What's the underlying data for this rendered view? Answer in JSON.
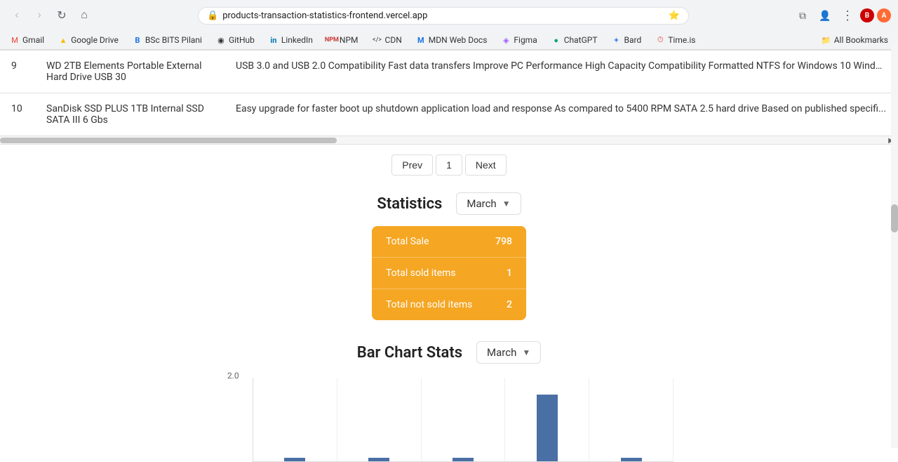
{
  "browser": {
    "url": "products-transaction-statistics-frontend.vercel.app",
    "nav": {
      "back": "‹",
      "forward": "›",
      "reload": "↻",
      "home": "⌂"
    },
    "bookmarks": [
      {
        "label": "Gmail",
        "icon": "M"
      },
      {
        "label": "Google Drive",
        "icon": "▲"
      },
      {
        "label": "BSc BITS Pilani",
        "icon": "B"
      },
      {
        "label": "GitHub",
        "icon": "◉"
      },
      {
        "label": "LinkedIn",
        "icon": "in"
      },
      {
        "label": "NPM",
        "icon": "◼"
      },
      {
        "label": "CDN",
        "icon": "</>"
      },
      {
        "label": "MDN Web Docs",
        "icon": "M"
      },
      {
        "label": "Figma",
        "icon": "◈"
      },
      {
        "label": "ChatGPT",
        "icon": "●"
      },
      {
        "label": "Bard",
        "icon": "✦"
      },
      {
        "label": "Time.is",
        "icon": "⏱"
      },
      {
        "label": "All Bookmarks",
        "icon": "☆"
      }
    ]
  },
  "table": {
    "rows": [
      {
        "number": "9",
        "name": "WD 2TB Elements Portable External Hard Drive USB 30",
        "description": "USB 3.0 and USB 2.0 Compatibility Fast data transfers Improve PC Performance High Capacity Compatibility Formatted NTFS for Windows 10 Windo..."
      },
      {
        "number": "10",
        "name": "SanDisk SSD PLUS 1TB Internal SSD SATA III 6 Gbs",
        "description": "Easy upgrade for faster boot up shutdown application load and response As compared to 5400 RPM SATA 2.5 hard drive Based on published specifi..."
      }
    ]
  },
  "pagination": {
    "prev_label": "Prev",
    "current_page": "1",
    "next_label": "Next"
  },
  "statistics": {
    "title": "Statistics",
    "month_label": "March",
    "total_sale_label": "Total Sale",
    "total_sale_value": "798",
    "total_sold_label": "Total sold items",
    "total_sold_value": "1",
    "total_not_sold_label": "Total not sold items",
    "total_not_sold_value": "2"
  },
  "bar_chart": {
    "title": "Bar Chart Stats",
    "month_label": "March",
    "y_axis_label": "2.0",
    "bars": [
      {
        "height": 10,
        "value": 0,
        "label": ""
      },
      {
        "height": 10,
        "value": 0,
        "label": ""
      },
      {
        "height": 10,
        "value": 0,
        "label": ""
      },
      {
        "height": 95,
        "value": 2,
        "label": ""
      },
      {
        "height": 10,
        "value": 0,
        "label": ""
      }
    ],
    "accent_color": "#4a6fa5"
  },
  "colors": {
    "stats_bg": "#f5a623",
    "bar_color": "#4a6fa5",
    "border": "#e0e0e0",
    "text_primary": "#222",
    "text_secondary": "#666"
  }
}
